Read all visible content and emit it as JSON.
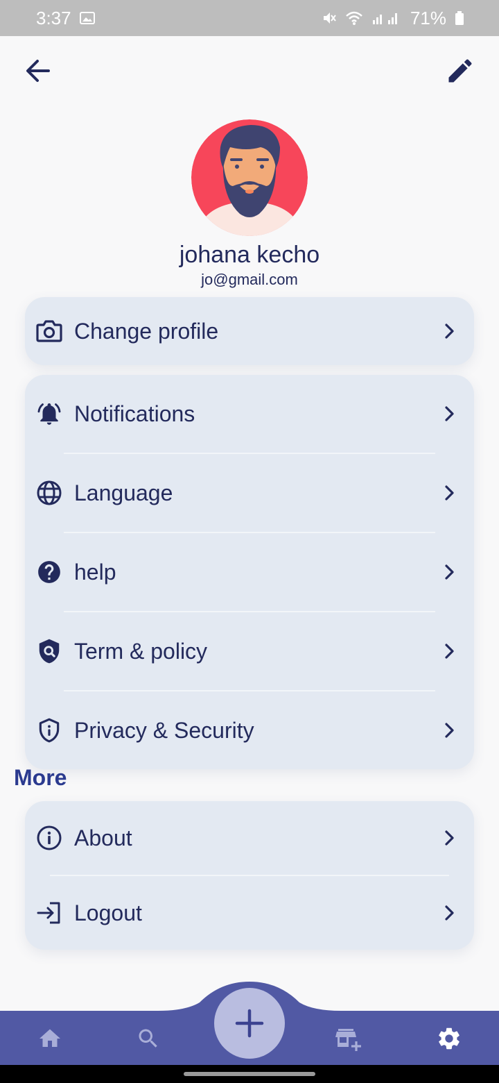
{
  "status_bar": {
    "time": "3:37",
    "battery": "71%",
    "icons": [
      "image-icon",
      "mute-icon",
      "wifi-icon",
      "signal-icon",
      "battery-icon"
    ]
  },
  "header": {
    "back_icon": "arrow-left-icon",
    "edit_icon": "pencil-icon"
  },
  "profile": {
    "name": "johana kecho",
    "email": "jo@gmail.com",
    "avatar_colors": {
      "background": "#f7465a",
      "hair": "#3f4470",
      "skin": "#f2aa79"
    }
  },
  "menu": {
    "change_profile": {
      "label": "Change profile",
      "icon": "camera-icon"
    },
    "settings": [
      {
        "label": "Notifications",
        "icon": "bell-icon"
      },
      {
        "label": "Language",
        "icon": "globe-icon"
      },
      {
        "label": "help",
        "icon": "help-circle-icon"
      },
      {
        "label": "Term & policy",
        "icon": "shield-search-icon"
      },
      {
        "label": "Privacy & Security",
        "icon": "shield-info-icon"
      }
    ]
  },
  "more": {
    "title": "More",
    "items": [
      {
        "label": "About",
        "icon": "info-icon"
      },
      {
        "label": "Logout",
        "icon": "logout-icon"
      }
    ]
  },
  "bottom_nav": {
    "items": [
      "home-icon",
      "search-icon",
      "add-icon",
      "store-add-icon",
      "settings-icon"
    ],
    "active": "settings-icon"
  },
  "colors": {
    "primary_text": "#232a5c",
    "card_bg": "#e3e9f2",
    "nav_bg": "#5159a4",
    "fab_bg": "#b9bde0",
    "section_title": "#2b3a8f"
  }
}
